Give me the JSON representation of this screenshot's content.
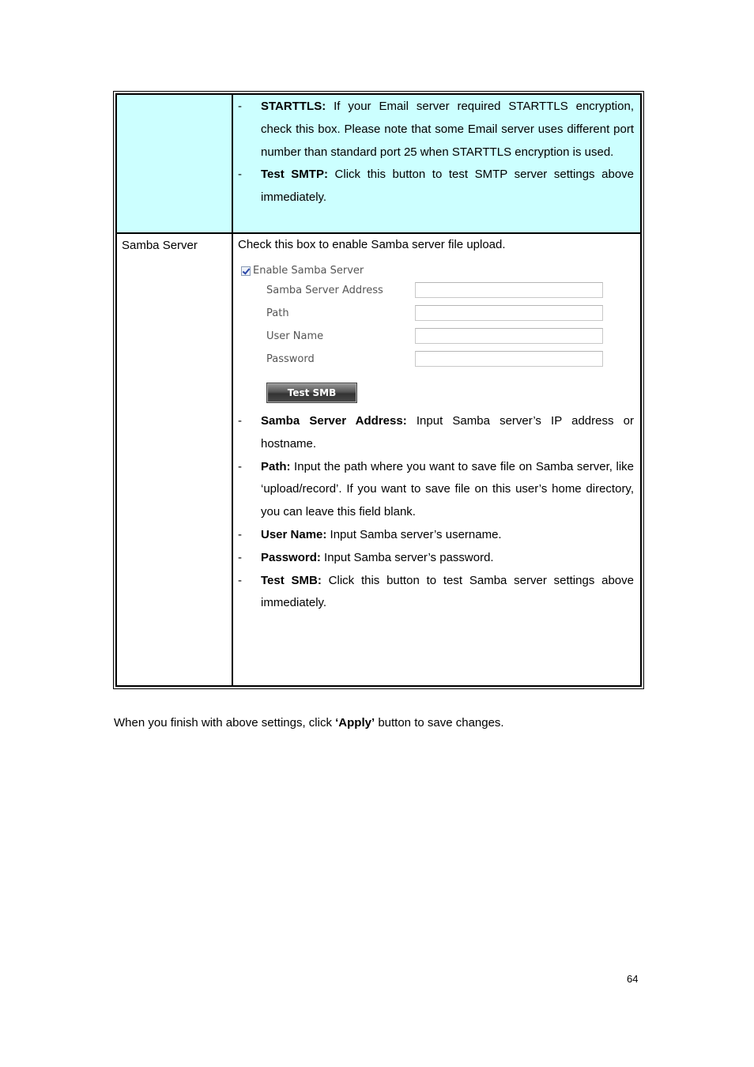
{
  "table": {
    "row1": {
      "left_label": "",
      "bullets": [
        {
          "term": "STARTTLS:",
          "text": " If your Email server required STARTTLS encryption, check this box. Please note that some Email server uses different port number than standard port 25 when STARTTLS encryption is used."
        },
        {
          "term": "Test SMTP:",
          "text": " Click this button to test SMTP server settings above immediately."
        }
      ]
    },
    "row2": {
      "left_label": "Samba Server",
      "intro": "Check this box to enable Samba server file upload.",
      "form": {
        "enable_checkbox_label": "Enable Samba Server",
        "enable_checked": true,
        "fields": [
          {
            "label": "Samba Server Address",
            "value": ""
          },
          {
            "label": "Path",
            "value": ""
          },
          {
            "label": "User Name",
            "value": ""
          },
          {
            "label": "Password",
            "value": ""
          }
        ],
        "test_button": "Test SMB"
      },
      "bullets": [
        {
          "term": "Samba Server Address:",
          "text": " Input Samba server’s IP address or hostname."
        },
        {
          "term": "Path:",
          "text": " Input the path where you want to save file on Samba server, like ‘upload/record’. If you want to save file on this user’s home directory, you can leave this field blank."
        },
        {
          "term": "User Name:",
          "text": " Input Samba server’s username."
        },
        {
          "term": "Password:",
          "text": " Input Samba server’s password."
        },
        {
          "term": "Test SMB:",
          "text": " Click this button to test Samba server settings above immediately."
        }
      ]
    }
  },
  "footer": {
    "before": "When you finish with above settings, click ",
    "bold": "‘Apply’",
    "after": " button to save changes."
  },
  "page_number": "64",
  "colors": {
    "highlight_row": "#ccffff"
  }
}
